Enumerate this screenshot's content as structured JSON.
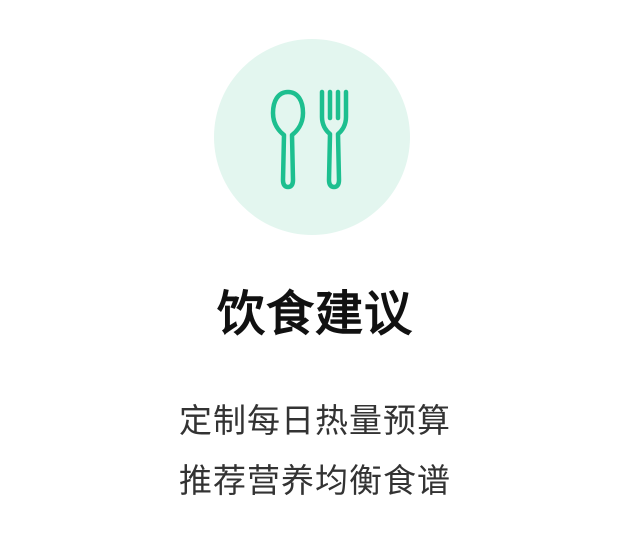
{
  "feature": {
    "icon": "utensils-icon",
    "accent_color": "#1dbf8f",
    "circle_color": "#e3f6ef",
    "title": "饮食建议",
    "description_lines": [
      "定制每日热量预算",
      "推荐营养均衡食谱"
    ]
  }
}
